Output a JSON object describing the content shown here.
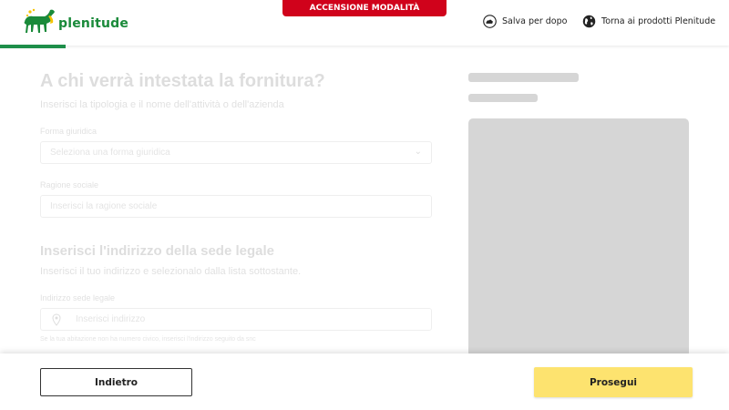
{
  "header": {
    "logo_text": "plenitude",
    "banner": "ACCENSIONE MODALITÀ COLLAUDO...",
    "save_label": "Salva per dopo",
    "back_products_label": "Torna ai prodotti Plenitude",
    "progress_fraction": 0.09,
    "accent_color": "#1e8f4a",
    "banner_color": "#d0021b"
  },
  "form": {
    "title": "A chi verrà intestata la fornitura?",
    "subtitle": "Inserisci la tipologia e il nome dell'attività o dell'azienda",
    "legal_form": {
      "label": "Forma giuridica",
      "placeholder": "Seleziona una forma giuridica",
      "icon": "chevron-down-icon"
    },
    "company_name": {
      "label": "Ragione sociale",
      "placeholder": "Inserisci la ragione sociale"
    },
    "address_section": {
      "title": "Inserisci l'indirizzo della sede legale",
      "subtitle": "Inserisci il tuo indirizzo e selezionalo dalla lista sottostante.",
      "field_label": "Indirizzo sede legale",
      "placeholder": "Inserisci indirizzo",
      "icon": "location-pin-icon",
      "hint": "Se la tua abitazione non ha numero civico, inserisci l'indirizzo seguito da snc"
    }
  },
  "footer": {
    "back_label": "Indietro",
    "next_label": "Prosegui",
    "next_color": "#fde36f"
  }
}
